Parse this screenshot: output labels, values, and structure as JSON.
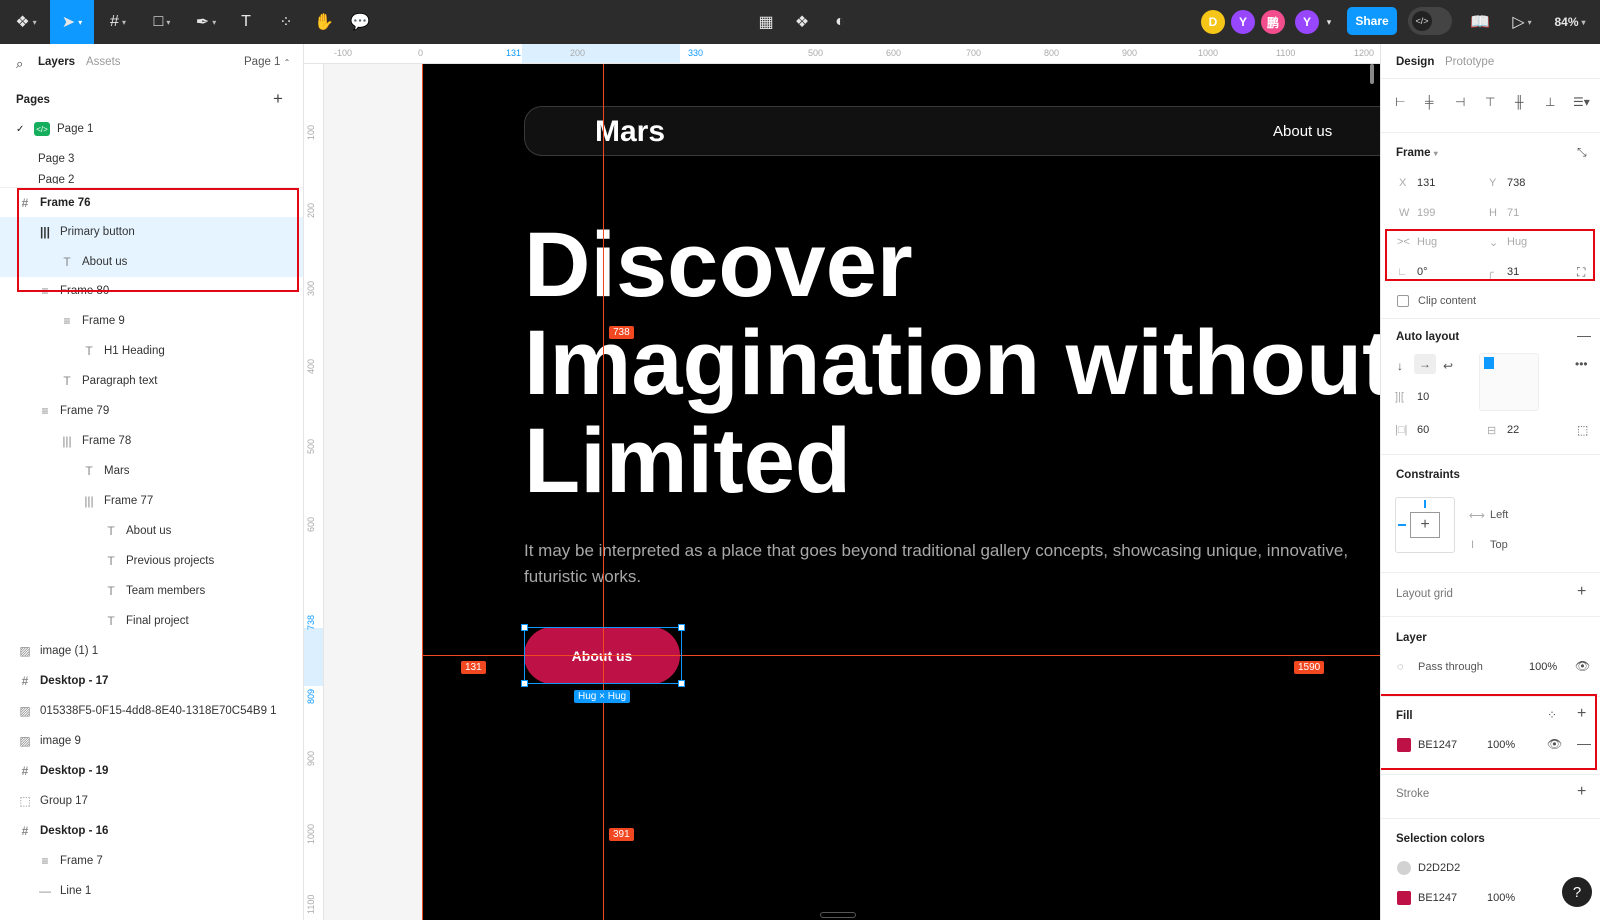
{
  "toolbar": {
    "zoom": "84%",
    "share_label": "Share",
    "avatars": [
      {
        "letter": "D",
        "color": "#f5c518"
      },
      {
        "letter": "Y",
        "color": "#9747ff"
      },
      {
        "letter": "鹏",
        "color": "#f24e8e"
      },
      {
        "letter": "Y",
        "color": "#9747ff"
      }
    ]
  },
  "left_panel": {
    "tabs": {
      "layers": "Layers",
      "assets": "Assets"
    },
    "page_selector": "Page 1",
    "pages_title": "Pages",
    "pages": [
      "Page 1",
      "Page 3",
      "Page 2"
    ],
    "layers": [
      {
        "name": "Frame 76",
        "icon": "#"
      },
      {
        "name": "Primary button",
        "icon": "|||"
      },
      {
        "name": "About us",
        "icon": "T"
      },
      {
        "name": "Frame 80",
        "icon": "≡"
      },
      {
        "name": "Frame 9",
        "icon": "≡"
      },
      {
        "name": "H1 Heading",
        "icon": "T"
      },
      {
        "name": "Paragraph text",
        "icon": "T"
      },
      {
        "name": "Frame 79",
        "icon": "≡"
      },
      {
        "name": "Frame 78",
        "icon": "|||"
      },
      {
        "name": "Mars",
        "icon": "T"
      },
      {
        "name": "Frame 77",
        "icon": "|||"
      },
      {
        "name": "About us",
        "icon": "T"
      },
      {
        "name": "Previous projects",
        "icon": "T"
      },
      {
        "name": "Team members",
        "icon": "T"
      },
      {
        "name": "Final project",
        "icon": "T"
      },
      {
        "name": "image (1) 1",
        "icon": "▨"
      },
      {
        "name": "Desktop - 17",
        "icon": "#"
      },
      {
        "name": "015338F5-0F15-4dd8-8E40-1318E70C54B9 1",
        "icon": "▨"
      },
      {
        "name": "image 9",
        "icon": "▨"
      },
      {
        "name": "Desktop - 19",
        "icon": "#"
      },
      {
        "name": "Group 17",
        "icon": "⬚"
      },
      {
        "name": "Desktop - 16",
        "icon": "#"
      },
      {
        "name": "Frame 7",
        "icon": "≡"
      },
      {
        "name": "Line 1",
        "icon": "—"
      }
    ]
  },
  "rulers": {
    "top": [
      "-100",
      "0",
      "131",
      "200",
      "330",
      "500",
      "600",
      "700",
      "800",
      "900",
      "1000",
      "1100",
      "1200"
    ],
    "left": [
      "100",
      "200",
      "300",
      "400",
      "500",
      "600",
      "738",
      "809",
      "900",
      "1000",
      "1100"
    ]
  },
  "canvas": {
    "brand": "Mars",
    "nav_link": "About us",
    "hero_lines": [
      "Discover",
      "Imagination without",
      "Limited"
    ],
    "paragraph_lines": [
      "It may be interpreted as a place that goes beyond traditional gallery concepts, showcasing unique, innovative,",
      "futuristic works."
    ],
    "cta_label": "About us",
    "measure_top": "738",
    "measure_bottom": "391",
    "measure_left": "131",
    "measure_right": "1590",
    "size_tag": "Hug × Hug"
  },
  "right_panel": {
    "tabs": {
      "design": "Design",
      "prototype": "Prototype"
    },
    "frame_title": "Frame",
    "x_label": "X",
    "x": "131",
    "y_label": "Y",
    "y": "738",
    "w_label": "W",
    "w": "199",
    "h_label": "H",
    "h": "71",
    "hug_w": "Hug",
    "hug_h": "Hug",
    "rotation": "0°",
    "radius": "31",
    "clip": "Clip content",
    "autolayout_title": "Auto layout",
    "gap": "10",
    "pad_h": "60",
    "pad_v": "22",
    "constraints_title": "Constraints",
    "constraint_h": "Left",
    "constraint_v": "Top",
    "layout_grid": "Layout grid",
    "layer_title": "Layer",
    "blend": "Pass through",
    "layer_opacity": "100%",
    "fill_title": "Fill",
    "fill_hex": "BE1247",
    "fill_opacity": "100%",
    "fill_color": "#be1247",
    "stroke_title": "Stroke",
    "selcolors_title": "Selection colors",
    "selcolors": [
      {
        "hex": "D2D2D2",
        "color": "#d2d2d2",
        "opacity": ""
      },
      {
        "hex": "BE1247",
        "color": "#be1247",
        "opacity": "100%"
      }
    ]
  }
}
